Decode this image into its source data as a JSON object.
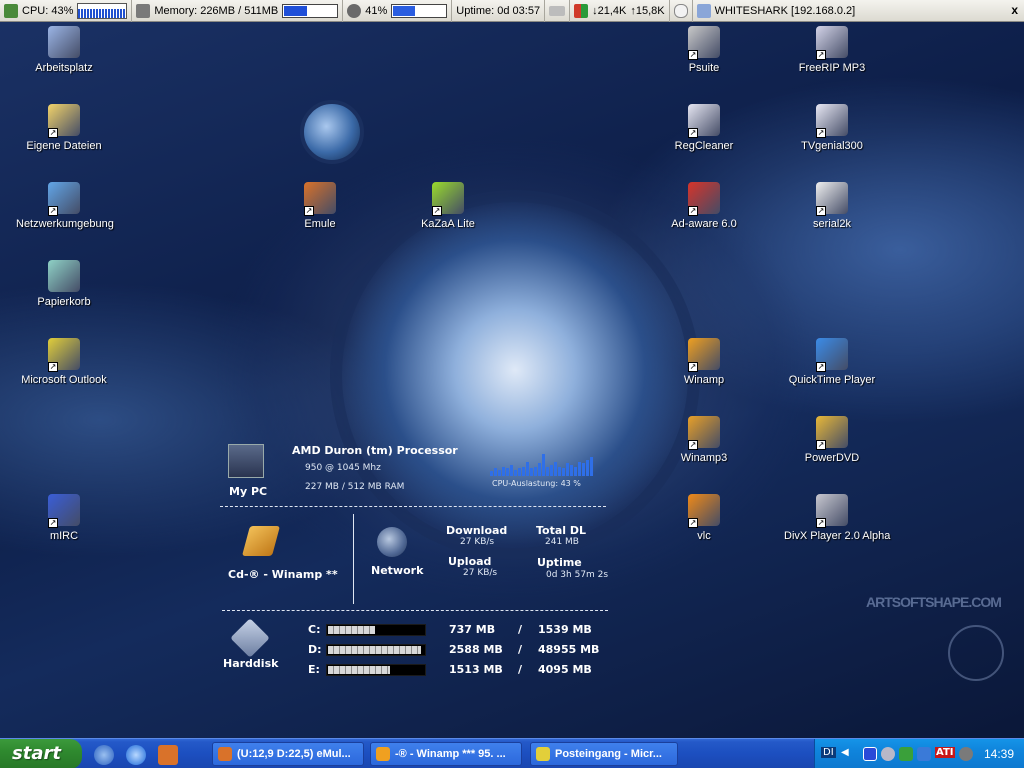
{
  "topbar": {
    "cpu": "CPU: 43%",
    "cpu_percent": 43,
    "memory": "Memory: 226MB / 511MB",
    "memory_fraction": 0.44,
    "battery": "41%",
    "battery_fraction": 0.41,
    "uptime": "Uptime: 0d 03:57",
    "net_down": "↓21,4K",
    "net_up": "↑15,8K",
    "host": "WHITESHARK [192.168.0.2]",
    "close": "x"
  },
  "desktop": {
    "icons": [
      {
        "label": "Arbeitsplatz",
        "icon": "my-computer-icon",
        "color": "#9bb5e6"
      },
      {
        "label": "Eigene Dateien",
        "icon": "my-documents-icon",
        "color": "#f3d46a"
      },
      {
        "label": "Netzwerkumgebung",
        "icon": "network-places-icon",
        "color": "#62a6e8"
      },
      {
        "label": "Papierkorb",
        "icon": "recycle-bin-icon",
        "color": "#8fd2c6"
      },
      {
        "label": "Microsoft Outlook",
        "icon": "outlook-icon",
        "color": "#e2cf3a"
      },
      {
        "label": "mIRC",
        "icon": "mirc-icon",
        "color": "#3a5ed8"
      },
      {
        "label": "Emule",
        "icon": "emule-icon",
        "color": "#d9722a"
      },
      {
        "label": "KaZaA Lite",
        "icon": "kazaa-icon",
        "color": "#9adc2c"
      },
      {
        "label": "Psuite",
        "icon": "psuite-icon",
        "color": "#c9c9c9"
      },
      {
        "label": "RegCleaner",
        "icon": "regcleaner-icon",
        "color": "#e6e6f2"
      },
      {
        "label": "Ad-aware 6.0",
        "icon": "adaware-icon",
        "color": "#d8342a"
      },
      {
        "label": "Winamp",
        "icon": "winamp-icon",
        "color": "#f0a020"
      },
      {
        "label": "Winamp3",
        "icon": "winamp3-icon",
        "color": "#e8a028"
      },
      {
        "label": "vlc",
        "icon": "vlc-icon",
        "color": "#f08a18"
      },
      {
        "label": "FreeRIP MP3",
        "icon": "freerip-icon",
        "color": "#d4d4e8"
      },
      {
        "label": "TVgenial300",
        "icon": "tvgenial-icon",
        "color": "#e8e8f4"
      },
      {
        "label": "serial2k",
        "icon": "serial2k-icon",
        "color": "#f0f0f0"
      },
      {
        "label": "QuickTime Player",
        "icon": "quicktime-icon",
        "color": "#3b8ce8"
      },
      {
        "label": "PowerDVD",
        "icon": "powerdvd-icon",
        "color": "#e8b838"
      },
      {
        "label": "DivX Player 2.0 Alpha",
        "icon": "divx-icon",
        "color": "#c8c8d0"
      }
    ]
  },
  "widget": {
    "mypc": "My PC",
    "cpu_name": "AMD Duron (tm) Processor",
    "cpu_speed": "950 @ 1045 Mhz",
    "ram": "227 MB / 512 MB RAM",
    "cpu_graph_label": "CPU-Auslastung: 43 %",
    "cpu_graph": [
      3,
      5,
      4,
      6,
      5,
      7,
      4,
      5,
      6,
      9,
      5,
      6,
      8,
      14,
      6,
      7,
      9,
      6,
      5,
      8,
      7,
      6,
      9,
      8,
      10,
      12
    ],
    "media": "Cd-® - Winamp **",
    "network": "Network",
    "download_label": "Download",
    "download_value": "27 KB/s",
    "upload_label": "Upload",
    "upload_value": "27 KB/s",
    "total_dl_label": "Total DL",
    "total_dl_value": "241 MB",
    "uptime_label": "Uptime",
    "uptime_value": "0d 3h 57m 2s",
    "harddisk": "Harddisk",
    "drives": [
      {
        "letter": "C:",
        "used": "737 MB",
        "sep": "/",
        "total": "1539 MB",
        "fraction": 0.48
      },
      {
        "letter": "D:",
        "used": "2588 MB",
        "sep": "/",
        "total": "48955 MB",
        "fraction": 0.95
      },
      {
        "letter": "E:",
        "used": "1513 MB",
        "sep": "/",
        "total": "4095 MB",
        "fraction": 0.63
      }
    ]
  },
  "watermark": "ARTSOFTSHAPE.COM",
  "taskbar": {
    "start": "start",
    "tasks": [
      {
        "label": "(U:12,9 D:22,5) eMul...",
        "icon": "emule-icon",
        "color": "#d9722a"
      },
      {
        "label": "-® - Winamp *** 95. ...",
        "icon": "winamp-icon",
        "color": "#f0a020"
      },
      {
        "label": "Posteingang - Micr...",
        "icon": "outlook-icon",
        "color": "#e2cf3a"
      }
    ],
    "tray_label": "DI",
    "ati": "ATI",
    "clock": "14:39"
  }
}
